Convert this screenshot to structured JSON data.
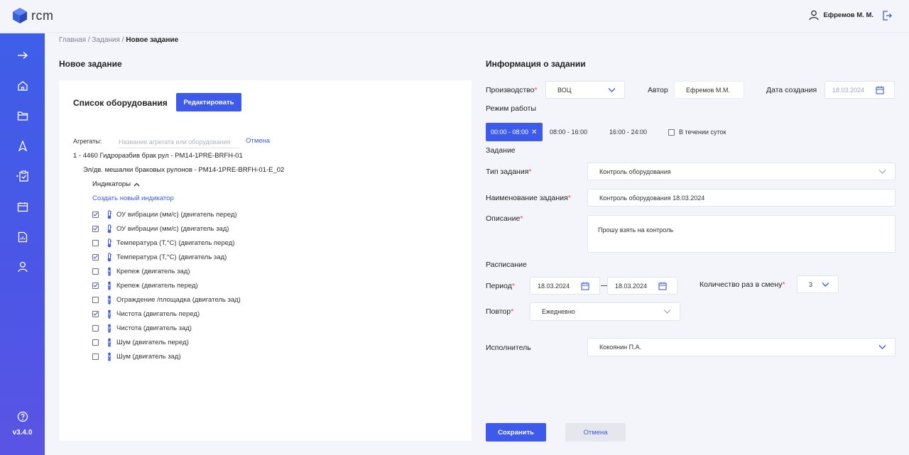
{
  "app": {
    "name": "rcm",
    "version": "v3.4.0"
  },
  "user": {
    "name": "Ефремов М. М."
  },
  "breadcrumb": {
    "home": "Главная",
    "tasks": "Задания",
    "current": "Новое задание",
    "sep": "/"
  },
  "left": {
    "title": "Новое задание",
    "card_title": "Список оборудования",
    "edit_label": "Редактировать",
    "aggregates_label": "Агрегаты:",
    "search_placeholder": "Название агрегата или оборудования",
    "cancel_link": "Отмена",
    "tree_level1": "1 - 4460 Гидроразбив брак рул - PM14-1PRE-BRFH-01",
    "tree_level2": "Эл/дв. мешалки браковых рулонов - PM14-1PRE-BRFH-01-E_02",
    "indicators_label": "Индикаторы",
    "create_indicator": "Создать новый индикатор",
    "indicators": [
      {
        "label": "ОУ вибрации (мм/с) (двигатель перед)",
        "checked": true,
        "icon": "thermometer-icon"
      },
      {
        "label": "ОУ вибрации (мм/с) (двигатель зад)",
        "checked": true,
        "icon": "thermometer-icon"
      },
      {
        "label": "Температура (T,°C) (двигатель перед)",
        "checked": false,
        "icon": "thermometer-icon"
      },
      {
        "label": "Температура (T,°C) (двигатель зад)",
        "checked": true,
        "icon": "thermometer-icon"
      },
      {
        "label": "Крепеж (двигатель зад)",
        "checked": false,
        "icon": "visual-check-icon"
      },
      {
        "label": "Крепеж (двигатель перед)",
        "checked": true,
        "icon": "visual-check-icon"
      },
      {
        "label": "Ограждение /площадка (двигатель зад)",
        "checked": false,
        "icon": "visual-check-icon"
      },
      {
        "label": "Чистота (двигатель перед)",
        "checked": true,
        "icon": "visual-check-icon"
      },
      {
        "label": "Чистота (двигатель зад)",
        "checked": false,
        "icon": "visual-check-icon"
      },
      {
        "label": "Шум (двигатель перед)",
        "checked": false,
        "icon": "visual-check-icon"
      },
      {
        "label": "Шум (двигатель зад)",
        "checked": false,
        "icon": "visual-check-icon"
      }
    ]
  },
  "right": {
    "title": "Информация о задании",
    "production_label": "Производство",
    "production_value": "ВОЦ",
    "author_label": "Автор",
    "author_value": "Ефремов М.М.",
    "created_label": "Дата создания",
    "created_value": "18.03.2024",
    "mode_label": "Режим работы",
    "shifts": [
      "00:00 - 08:00",
      "08:00 - 16:00",
      "16:00 - 24:00"
    ],
    "around_clock": "В течении суток",
    "task_section": "Задание",
    "type_label": "Тип задания",
    "type_value": "Контроль оборудования",
    "name_label": "Наименование задания",
    "name_value": "Контроль оборудования 18.03.2024",
    "desc_label": "Описание",
    "desc_value": "Прошу взять на контроль",
    "schedule_section": "Расписание",
    "period_label": "Период",
    "period_from": "18.03.2024",
    "period_to": "18.03.2024",
    "count_label": "Количество раз в смену",
    "count_value": "3",
    "repeat_label": "Повтор",
    "repeat_value": "Ежедневно",
    "executor_label": "Исполнитель",
    "executor_value": "Кокоянин П.А.",
    "save_label": "Сохранить",
    "cancel_label": "Отмена"
  },
  "colors": {
    "accent": "#3d5aeb",
    "required": "#e34b4b"
  }
}
